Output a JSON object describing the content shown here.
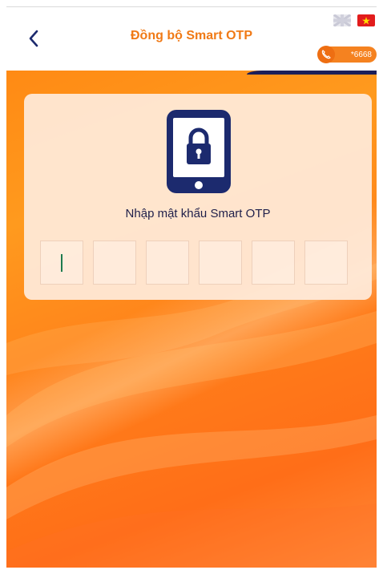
{
  "header": {
    "title": "Đồng bộ Smart OTP",
    "hotline": "*6668",
    "icons": [
      "back-chevron",
      "flag-uk",
      "flag-vietnam",
      "phone"
    ]
  },
  "card": {
    "label": "Nhập mật khẩu Smart OTP",
    "otp_digits": [
      "",
      "",
      "",
      "",
      "",
      ""
    ],
    "icon": "phone-lock"
  },
  "colors": {
    "accent": "#f07a16",
    "navy": "#1c2a6e",
    "hotline_bg": "#f58220"
  }
}
